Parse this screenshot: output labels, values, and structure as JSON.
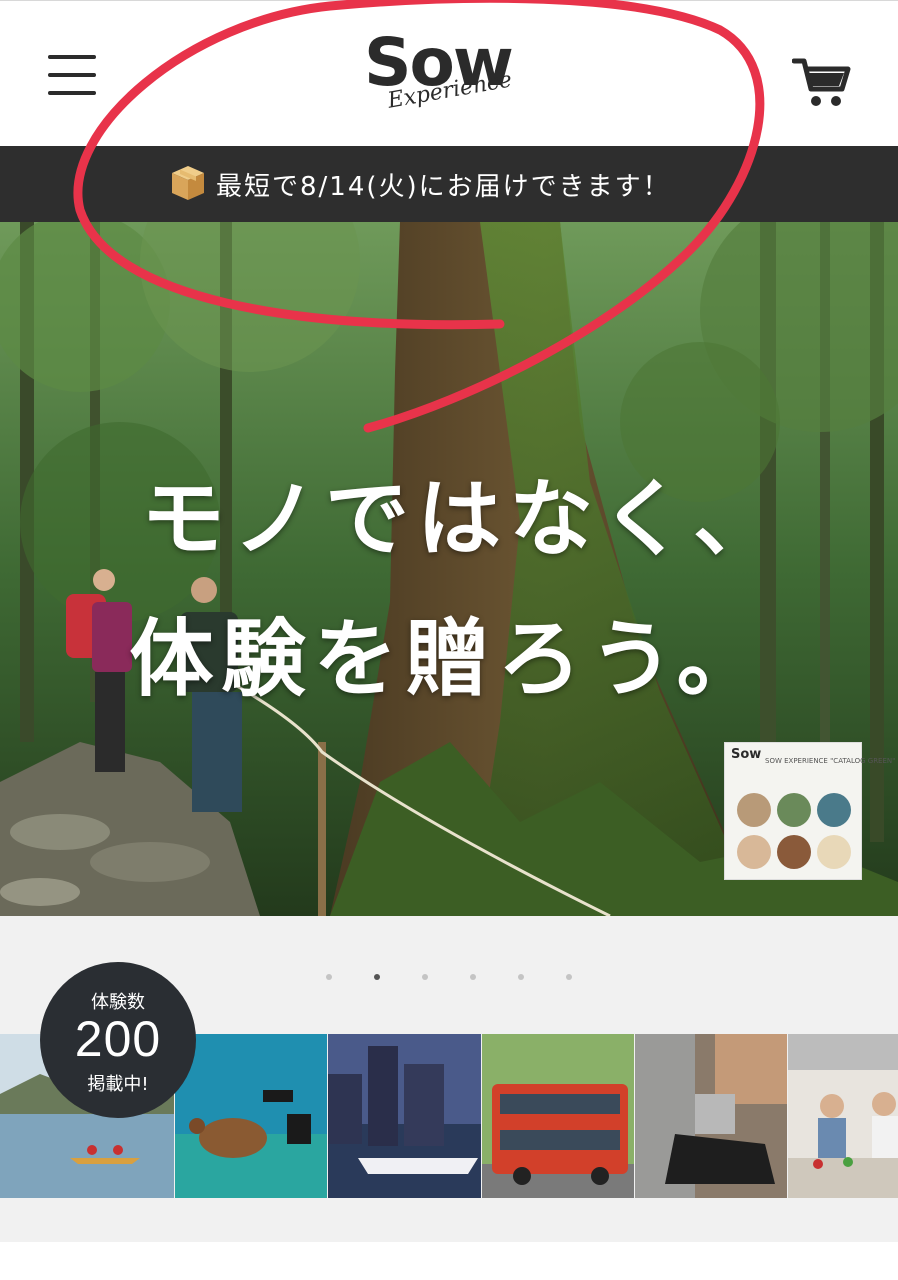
{
  "header": {
    "logo_main": "Sow",
    "logo_sub": "Experience",
    "menu_icon": "hamburger-menu-icon",
    "cart_icon": "shopping-cart-icon"
  },
  "delivery_banner": {
    "icon": "package-box-icon",
    "text": "最短で8/14(火)にお届けできます！"
  },
  "hero": {
    "headline_line1": "モノではなく、",
    "headline_line2": "体験を贈ろう。",
    "catalog_thumb": {
      "logo": "Sow",
      "title": "SOW EXPERIENCE \"CATALOG GREEN\""
    }
  },
  "slider": {
    "dot_count": 6,
    "active_index": 1
  },
  "experience_count": {
    "label": "体験数",
    "number": "200",
    "suffix": "掲載中!"
  },
  "tiles": [
    {
      "name": "tile-canoe-lake",
      "icon": "canoe-lake-photo"
    },
    {
      "name": "tile-sea-turtle-dive",
      "icon": "sea-turtle-photo"
    },
    {
      "name": "tile-night-cruise",
      "icon": "city-cruise-photo"
    },
    {
      "name": "tile-sightseeing-bus",
      "icon": "double-decker-bus-photo"
    },
    {
      "name": "tile-shoe-making",
      "icon": "shoe-craft-photo"
    },
    {
      "name": "tile-cooking-class",
      "icon": "cooking-class-photo"
    }
  ],
  "colors": {
    "banner_bg": "#2e2e2e",
    "annotation_red": "#e8334a",
    "badge_bg": "#2a2e33",
    "slider_bg": "#f1f1f1"
  }
}
